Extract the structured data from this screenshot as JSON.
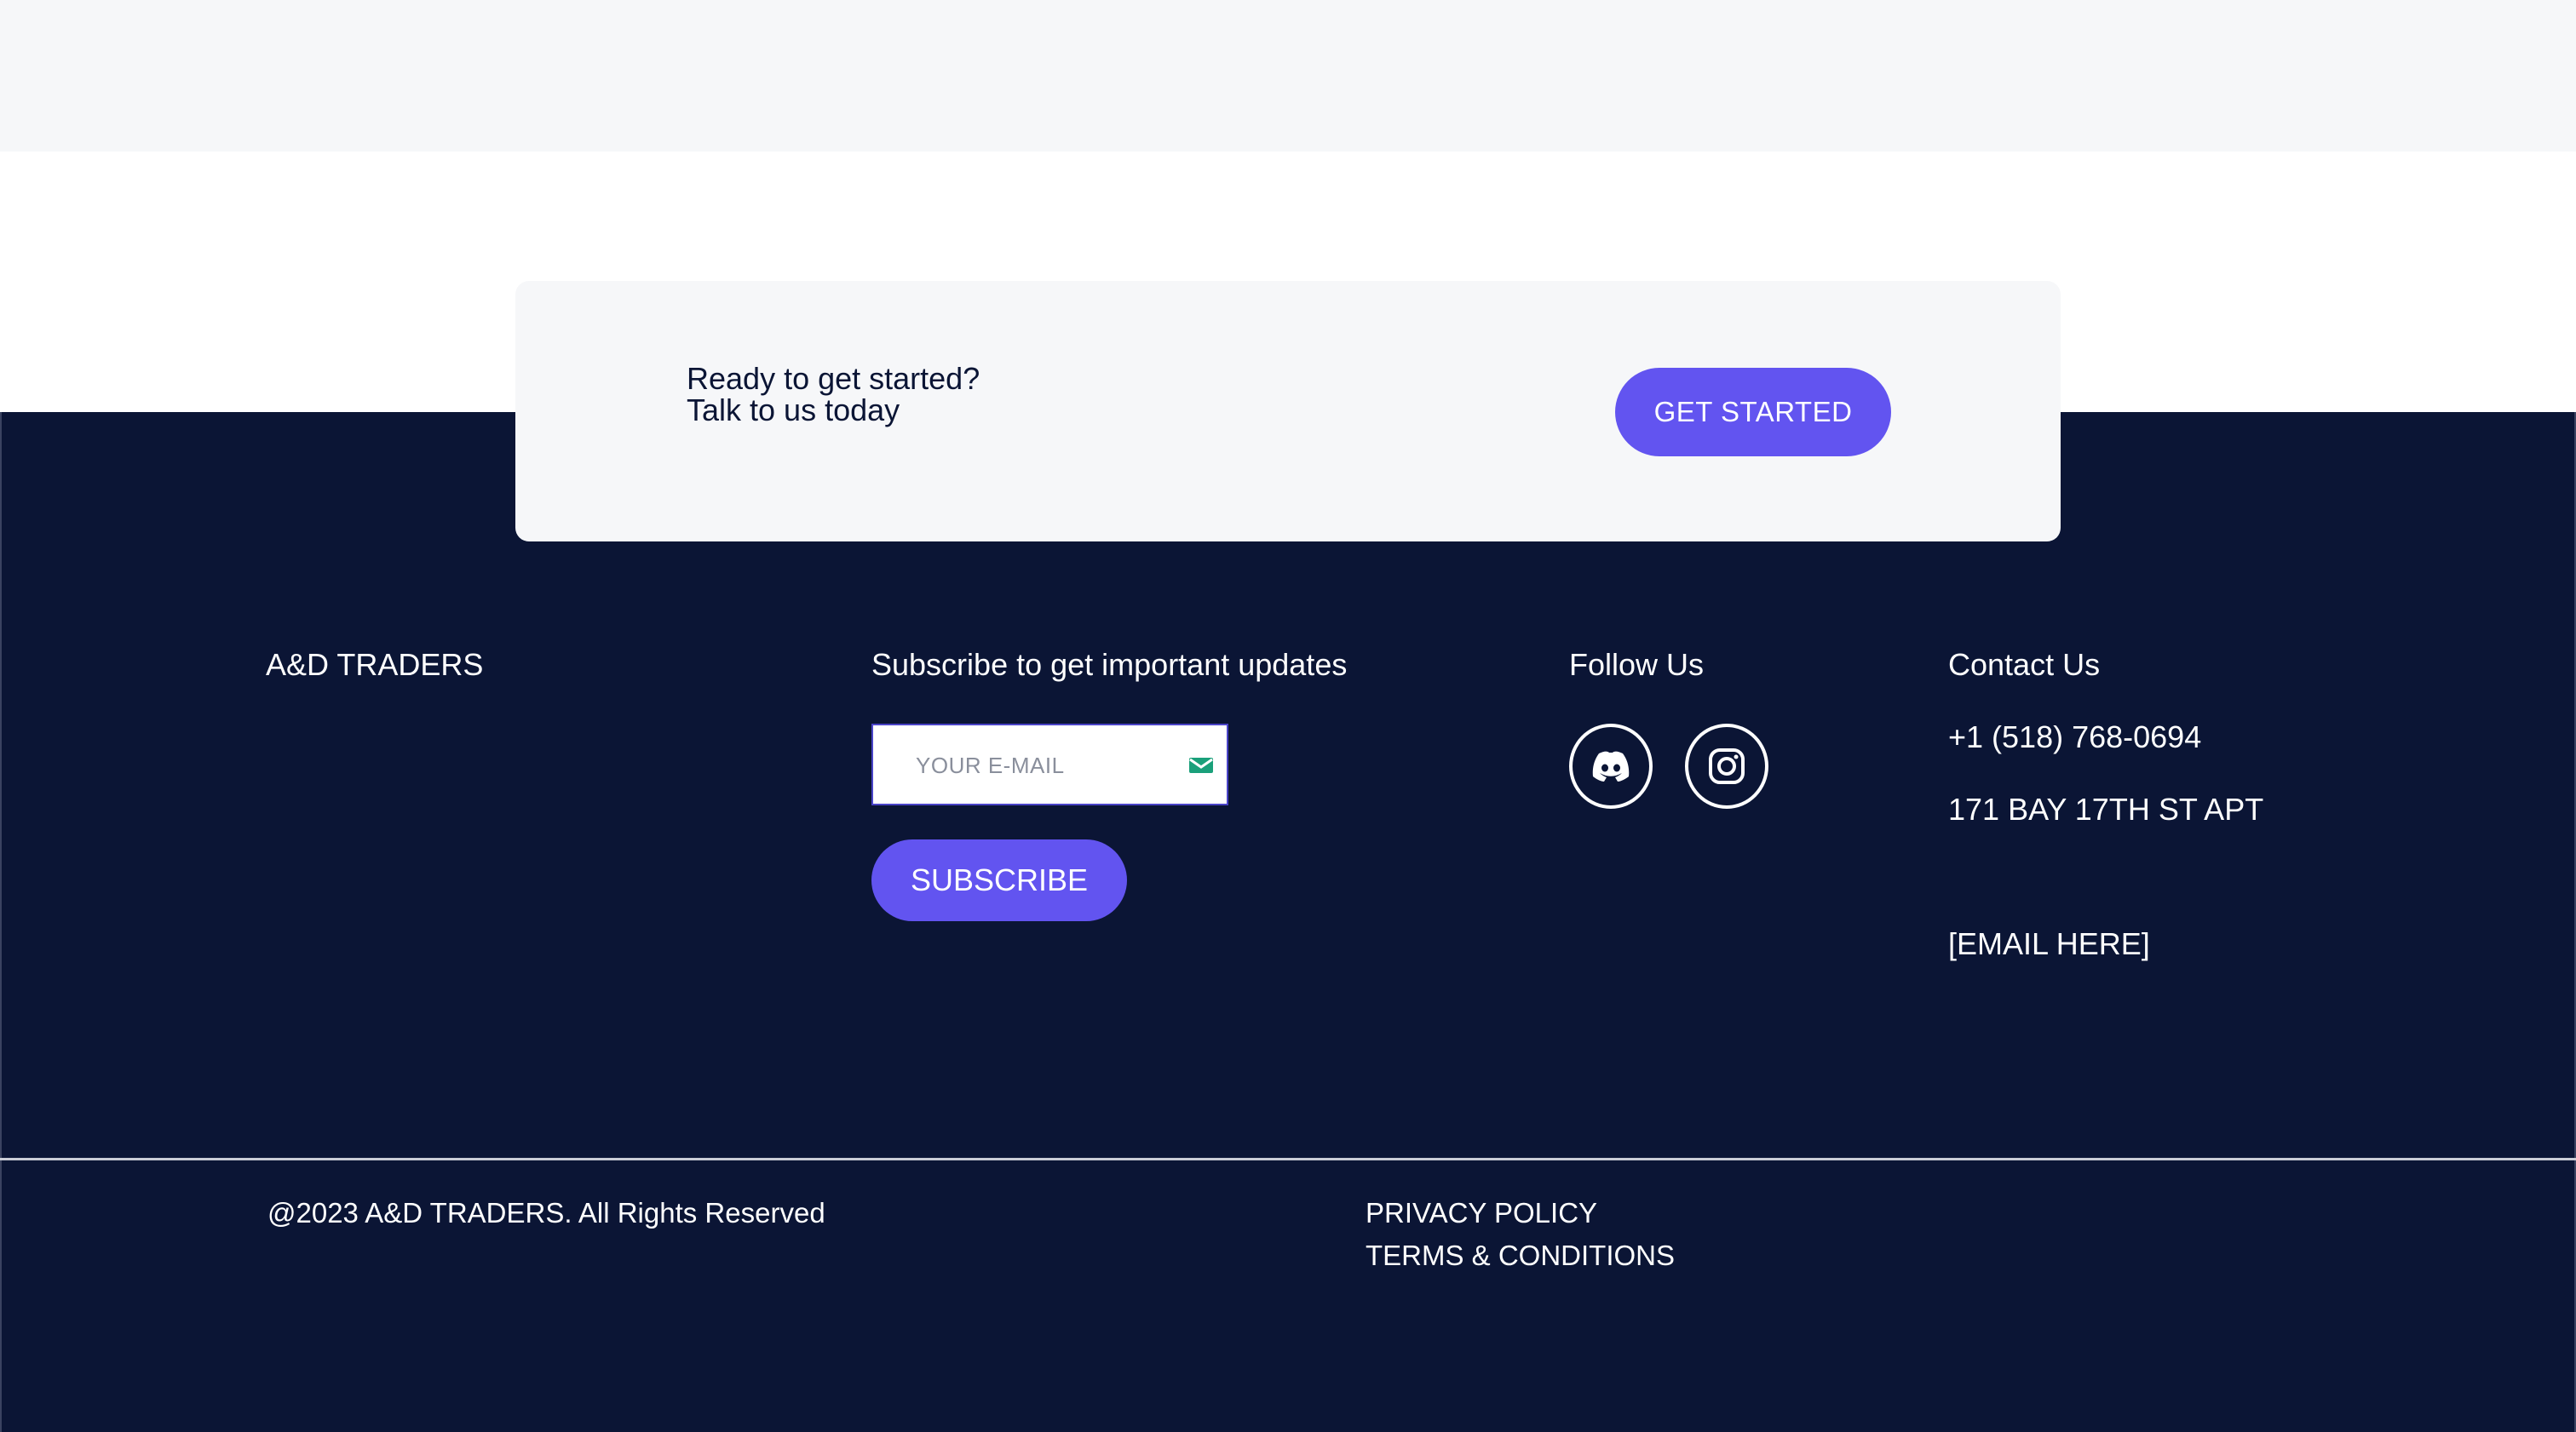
{
  "cta": {
    "line1": "Ready to get started?",
    "line2": "Talk to us today",
    "button_label": "GET STARTED"
  },
  "footer": {
    "brand": "A&D TRADERS",
    "subscribe": {
      "title": "Subscribe to get important updates",
      "email_placeholder": "YOUR E-MAIL",
      "button_label": "SUBSCRIBE"
    },
    "follow": {
      "title": "Follow Us",
      "icons": [
        "discord-icon",
        "instagram-icon"
      ]
    },
    "contact": {
      "title": "Contact Us",
      "phone": "+1 (518) 768-0694",
      "address": "171 BAY 17TH ST APT",
      "email": "[EMAIL HERE]"
    },
    "copyright": "@2023 A&D TRADERS. All Rights Reserved",
    "links": {
      "privacy": "PRIVACY POLICY",
      "terms": "TERMS & CONDITIONS"
    }
  },
  "colors": {
    "footer_bg": "#0b1535",
    "accent": "#6254f0",
    "card_bg": "#f6f7f9"
  }
}
